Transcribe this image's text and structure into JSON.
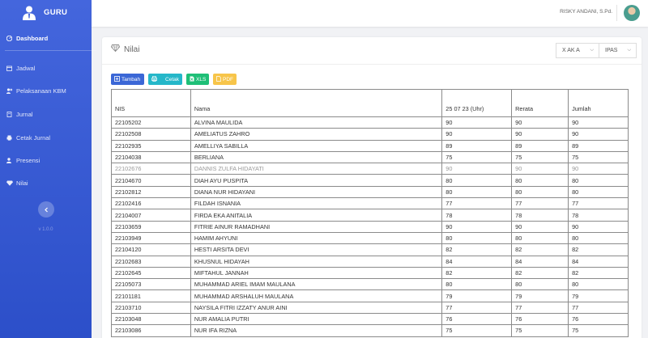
{
  "brand": {
    "title": "GURU"
  },
  "sidebar": {
    "items": [
      {
        "label": "Dashboard",
        "icon": "dashboard-icon"
      },
      {
        "label": "Jadwal",
        "icon": "calendar-icon"
      },
      {
        "label": "Pelaksanaan KBM",
        "icon": "users-icon"
      },
      {
        "label": "Jurnal",
        "icon": "book-icon"
      },
      {
        "label": "Cetak Jurnal",
        "icon": "print-icon"
      },
      {
        "label": "Presensi",
        "icon": "user-check-icon"
      },
      {
        "label": "Nilai",
        "icon": "diamond-icon"
      }
    ],
    "version": "v 1.0.0"
  },
  "topbar": {
    "user_name": "RISKY ANDANI, S.Pd."
  },
  "page": {
    "title": "Nilai",
    "class_select": "X AK A",
    "subject_select": "IPAS"
  },
  "toolbar": {
    "tambah": "Tambah",
    "cetak": "Cetak",
    "xls": "XLS",
    "pdf": "PDF"
  },
  "table": {
    "headers": [
      "NIS",
      "Nama",
      "25 07 23 (Uhr)",
      "Rerata",
      "Jumlah"
    ],
    "rows": [
      [
        "22105202",
        "ALVINA MAULIDA",
        "90",
        "90",
        "90"
      ],
      [
        "22102508",
        "AMELIATUS ZAHRO",
        "90",
        "90",
        "90"
      ],
      [
        "22102935",
        "AMELLIYA SABILLA",
        "89",
        "89",
        "89"
      ],
      [
        "22104038",
        "BERLIANA",
        "75",
        "75",
        "75"
      ],
      [
        "22102676",
        "DANNIS ZULFA HIDAYATI",
        "90",
        "90",
        "90"
      ],
      [
        "22104670",
        "DIAH AYU PUSPITA",
        "80",
        "80",
        "80"
      ],
      [
        "22102812",
        "DIANA NUR HIDAYANI",
        "80",
        "80",
        "80"
      ],
      [
        "22102416",
        "FILDAH ISNANIA",
        "77",
        "77",
        "77"
      ],
      [
        "22104007",
        "FIRDA EKA ANITALIA",
        "78",
        "78",
        "78"
      ],
      [
        "22103659",
        "FITRIE AINUR RAMADHANI",
        "90",
        "90",
        "90"
      ],
      [
        "22103949",
        "HAMIM AHYUNI",
        "80",
        "80",
        "80"
      ],
      [
        "22104120",
        "HESTI ARSITA DEVI",
        "82",
        "82",
        "82"
      ],
      [
        "22102683",
        "KHUSNUL HIDAYAH",
        "84",
        "84",
        "84"
      ],
      [
        "22102645",
        "MIFTAHUL JANNAH",
        "82",
        "82",
        "82"
      ],
      [
        "22105073",
        "MUHAMMAD ARIEL IMAM MAULANA",
        "80",
        "80",
        "80"
      ],
      [
        "22101181",
        "MUHAMMAD ARSHALUH MAULANA",
        "79",
        "79",
        "79"
      ],
      [
        "22103710",
        "NAYSILA FITRI IZZATY ANUR AINI",
        "77",
        "77",
        "77"
      ],
      [
        "22103048",
        "NUR AMALIA PUTRI",
        "76",
        "76",
        "76"
      ],
      [
        "22103086",
        "NUR IFA RIZNA",
        "75",
        "75",
        "75"
      ]
    ]
  }
}
